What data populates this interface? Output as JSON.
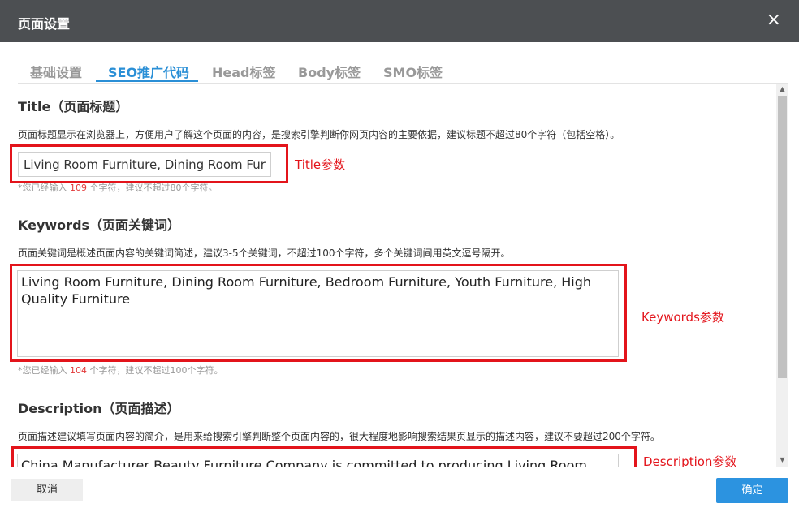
{
  "dialog": {
    "title": "页面设置",
    "close_icon": "×"
  },
  "tabs": [
    {
      "label": "基础设置"
    },
    {
      "label": "SEO推广代码",
      "active": true
    },
    {
      "label": "Head标签"
    },
    {
      "label": "Body标签"
    },
    {
      "label": "SMO标签"
    }
  ],
  "title_section": {
    "heading": "Title（页面标题）",
    "description": "页面标题显示在浏览器上，方便用户了解这个页面的内容，是搜索引擎判断你网页内容的主要依据，建议标题不超过80个字符（包括空格）。",
    "value": "Living Room Furniture, Dining Room Furnitur",
    "hint_prefix": "*您已经输入 ",
    "hint_count": "109",
    "hint_suffix": " 个字符，建议不超过80个字符。",
    "annotation": "Title参数"
  },
  "keywords_section": {
    "heading": "Keywords（页面关键词）",
    "description": "页面关键词是概述页面内容的关键词简述，建议3-5个关键词，不超过100个字符，多个关键词间用英文逗号隔开。",
    "value": "Living Room Furniture, Dining Room Furniture, Bedroom Furniture, Youth Furniture, High Quality Furniture",
    "hint_prefix": "*您已经输入 ",
    "hint_count": "104",
    "hint_suffix": " 个字符，建议不超过100个字符。",
    "annotation": "Keywords参数"
  },
  "description_section": {
    "heading": "Description（页面描述）",
    "description": "页面描述建议填写页面内容的简介，是用来给搜索引擎判断整个页面内容的，很大程度地影响搜索结果页显示的描述内容，建议不要超过200个字符。",
    "value": "China Manufacturer Beauty Furniture Company is committed to producing Living Room",
    "annotation": "Description参数"
  },
  "footer": {
    "cancel_label": "取消",
    "ok_label": "确定"
  },
  "colors": {
    "accent": "#2a8fd6",
    "annotation_red": "#e3141b",
    "titlebar": "#4c4f52",
    "ok_button": "#2c93e0"
  }
}
